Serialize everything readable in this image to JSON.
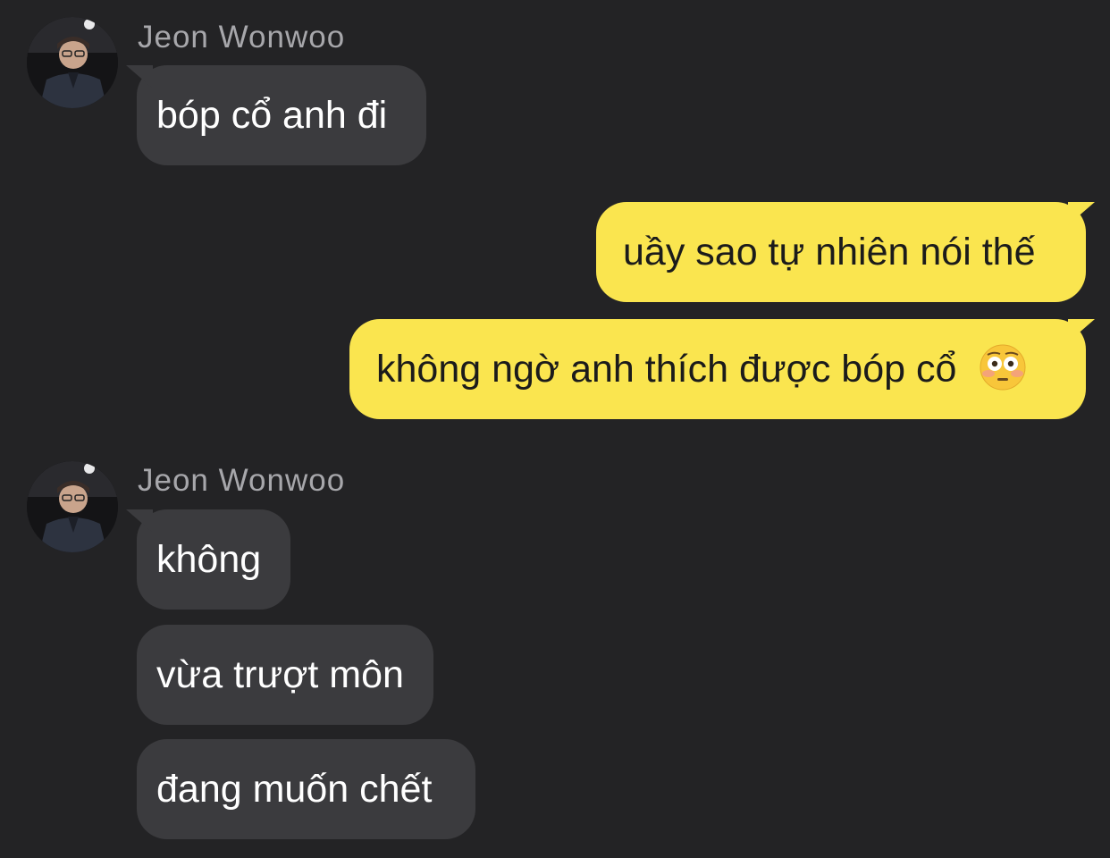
{
  "contact": {
    "name": "Jeon Wonwoo"
  },
  "messages": {
    "group1": {
      "sender": "Jeon Wonwoo",
      "m1": "bóp cổ anh đi"
    },
    "outgoing": {
      "m1": "uầy sao tự nhiên nói thế",
      "m2": "không ngờ anh thích được bóp cổ",
      "m2_emoji": "flushed-face-emoji"
    },
    "group2": {
      "sender": "Jeon Wonwoo",
      "m1": "không",
      "m2": "vừa trượt môn",
      "m3": "đang muốn chết"
    }
  },
  "colors": {
    "background": "#232325",
    "incoming_bubble": "#3b3b3e",
    "outgoing_bubble": "#fae54f",
    "sender_name": "#a7a7ab"
  }
}
